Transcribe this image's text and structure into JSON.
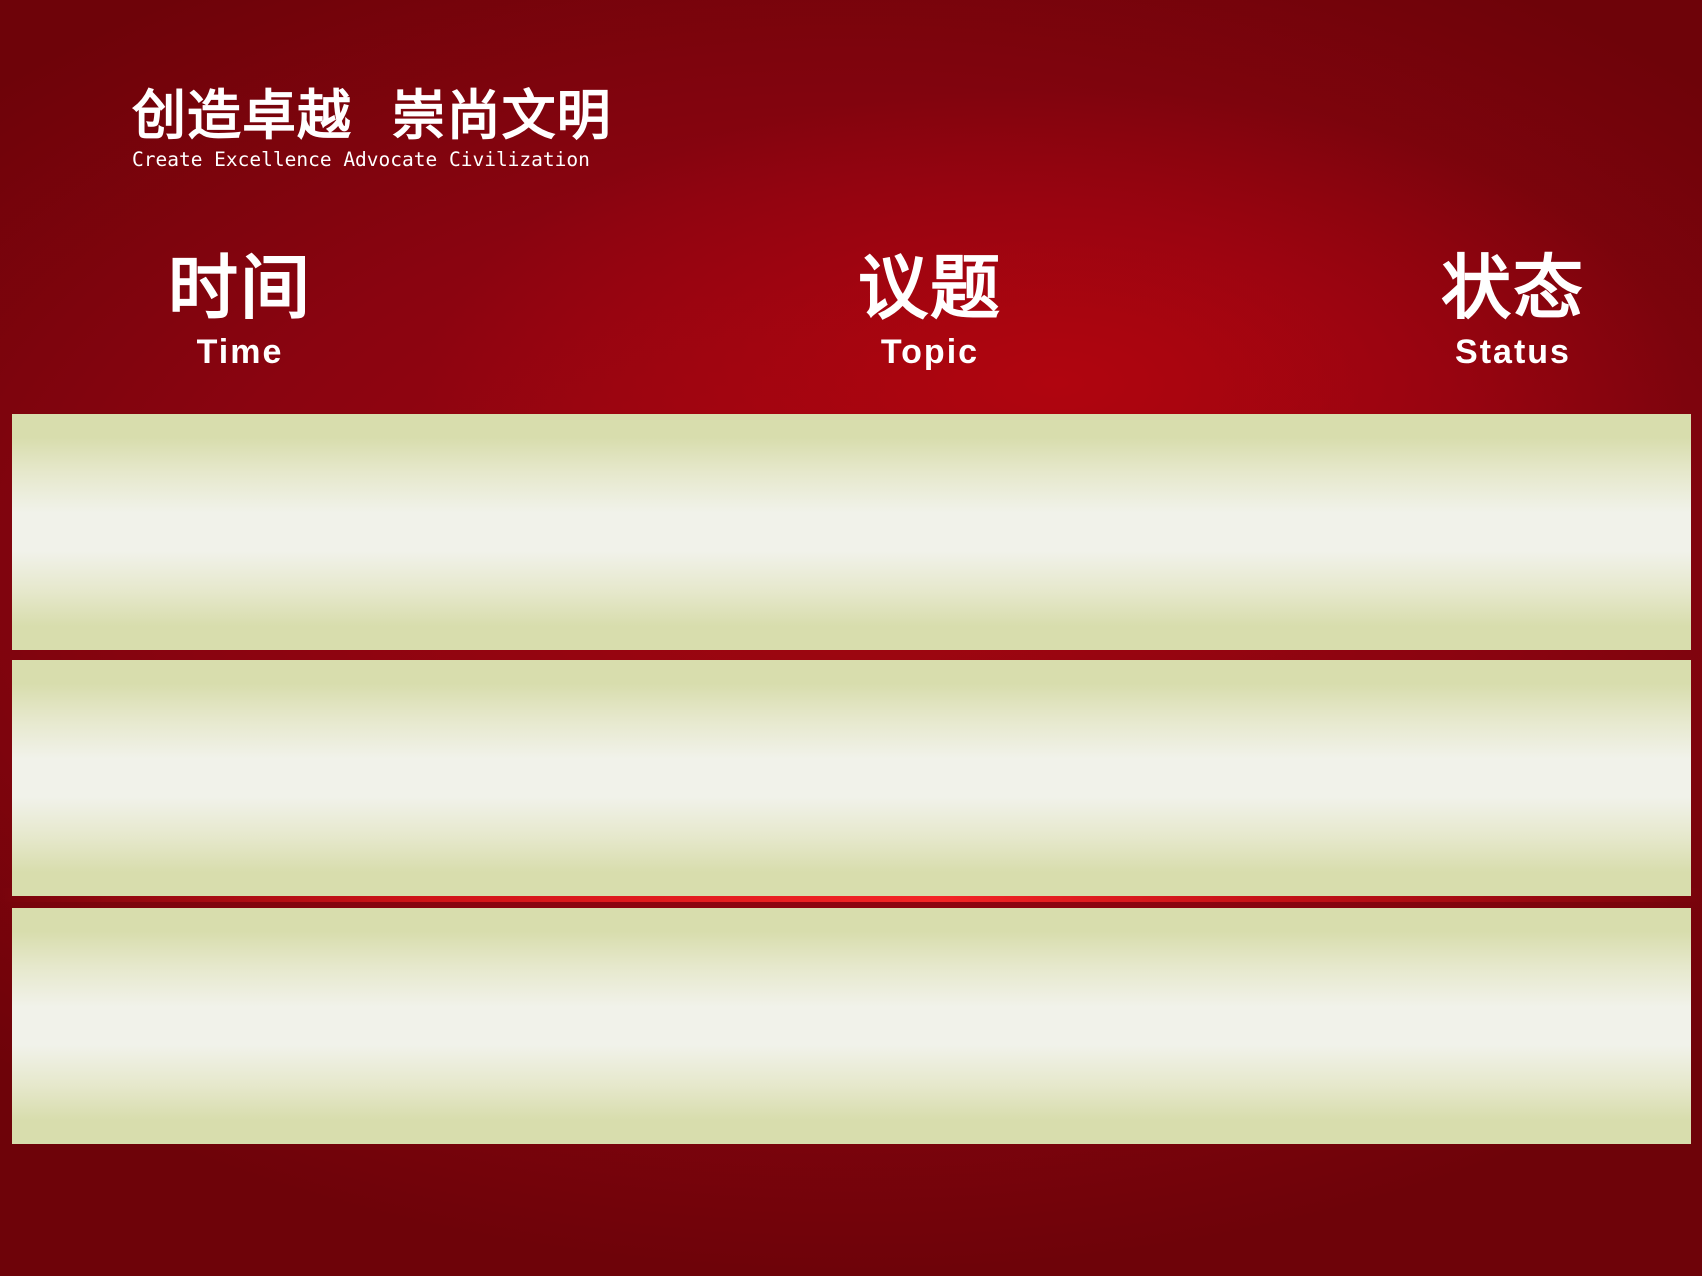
{
  "slogan": {
    "chinese": "创造卓越  崇尚文明",
    "english": "Create Excellence Advocate Civilization"
  },
  "columns": [
    {
      "cn": "时间",
      "en": "Time"
    },
    {
      "cn": "议题",
      "en": "Topic"
    },
    {
      "cn": "状态",
      "en": "Status"
    }
  ],
  "rows": [
    {
      "time": "",
      "topic": "",
      "status": ""
    },
    {
      "time": "",
      "topic": "",
      "status": ""
    },
    {
      "time": "",
      "topic": "",
      "status": ""
    }
  ],
  "colors": {
    "background": "#9a0510",
    "row_fill": "#d8ddad",
    "row_highlight": "#f1f2ea",
    "text": "#ffffff"
  }
}
